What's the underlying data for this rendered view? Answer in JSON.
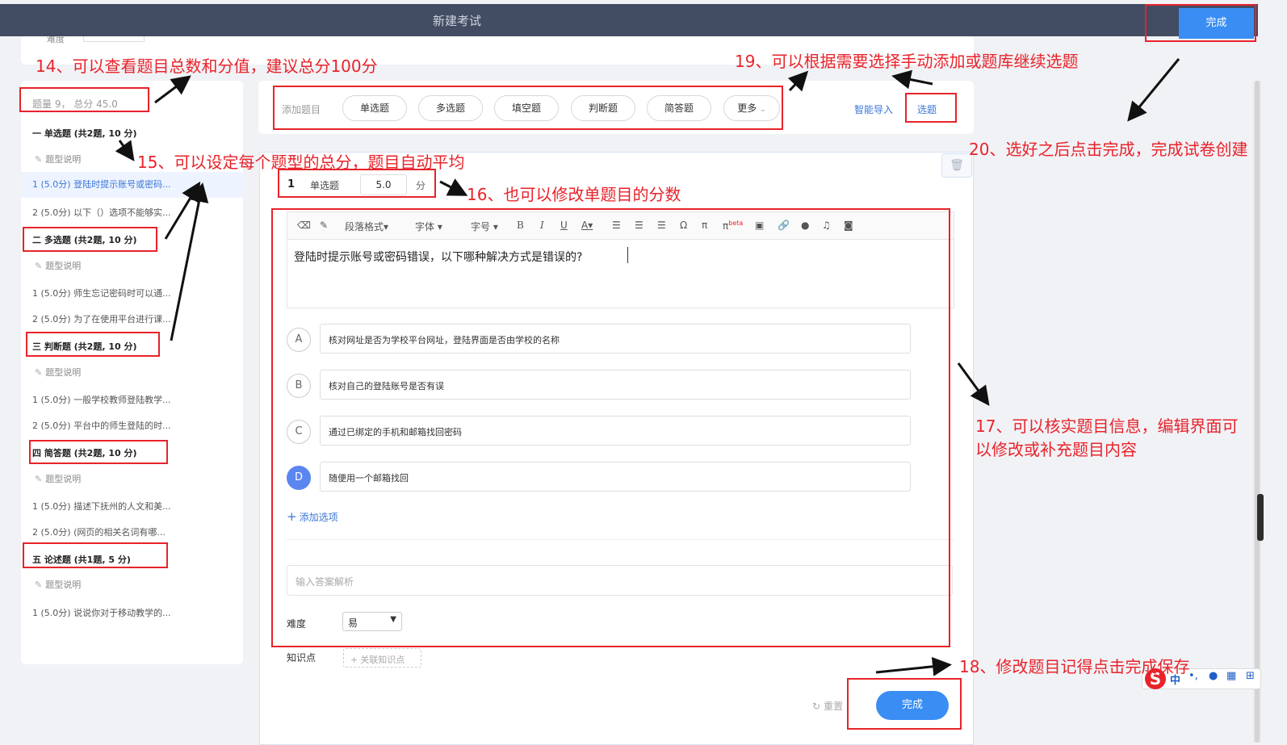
{
  "header": {
    "title": "新建考试",
    "done_label": "完成"
  },
  "left_panel": {
    "summary": "题量 9， 总分 45.0",
    "desc_label": "题型说明",
    "sections": [
      {
        "title": "一 单选题 (共2题, 10 分)",
        "items": [
          "1 (5.0分) 登陆时提示账号或密码...",
          "2 (5.0分) 以下（）选项不能够实..."
        ]
      },
      {
        "title": "二 多选题 (共2题, 10 分)",
        "items": [
          "1 (5.0分) 师生忘记密码时可以通...",
          "2 (5.0分) 为了在使用平台进行课..."
        ]
      },
      {
        "title": "三 判断题 (共2题, 10 分)",
        "items": [
          "1 (5.0分) 一般学校教师登陆教学...",
          "2 (5.0分) 平台中的师生登陆的时..."
        ]
      },
      {
        "title": "四 简答题 (共2题, 10 分)",
        "items": [
          "1 (5.0分) 描述下抚州的人文和美...",
          "2 (5.0分) (网页的相关名词有哪..."
        ]
      },
      {
        "title": "五 论述题 (共1题, 5 分)",
        "items": [
          "1 (5.0分) 说说你对于移动教学的..."
        ]
      }
    ]
  },
  "type_bar": {
    "add_label": "添加题目",
    "types": [
      "单选题",
      "多选题",
      "填空题",
      "判断题",
      "简答题",
      "更多"
    ],
    "smart_import": "智能导入",
    "select_label": "选题"
  },
  "question": {
    "number": "1",
    "type": "单选题",
    "score": "5.0",
    "unit": "分",
    "toolbar": {
      "paragraph": "段落格式",
      "font": "字体",
      "size": "字号",
      "beta": "beta"
    },
    "stem": "登陆时提示账号或密码错误，以下哪种解决方式是错误的?",
    "options": [
      {
        "letter": "A",
        "text": "核对网址是否为学校平台网址，登陆界面是否由学校的名称"
      },
      {
        "letter": "B",
        "text": "核对自己的登陆账号是否有误"
      },
      {
        "letter": "C",
        "text": "通过已绑定的手机和邮箱找回密码"
      },
      {
        "letter": "D",
        "text": "随便用一个邮箱找回"
      }
    ],
    "add_option": "添加选项",
    "analysis_placeholder": "输入答案解析",
    "difficulty_label": "难度",
    "difficulty_value": "易",
    "knowledge_label": "知识点",
    "knowledge_button": "关联知识点",
    "reset_label": "重置",
    "done_label": "完成"
  },
  "annotations": {
    "a14": "14、可以查看题目总数和分值，建议总分100分",
    "a15": "15、可以设定每个题型的总分，题目自动平均",
    "a16": "16、也可以修改单题目的分数",
    "a17_1": "17、可以核实题目信息，编辑界面可",
    "a17_2": "以修改或补充题目内容",
    "a18": "18、修改题目记得点击完成保存",
    "a19": "19、可以根据需要选择手动添加或题库继续选题",
    "a20": "20、选好之后点击完成，完成试卷创建"
  },
  "ime": {
    "logo": "S",
    "lang": "中"
  },
  "colors": {
    "annotation": "#e8232a",
    "primary": "#3a8ef3",
    "header": "#424d63"
  }
}
